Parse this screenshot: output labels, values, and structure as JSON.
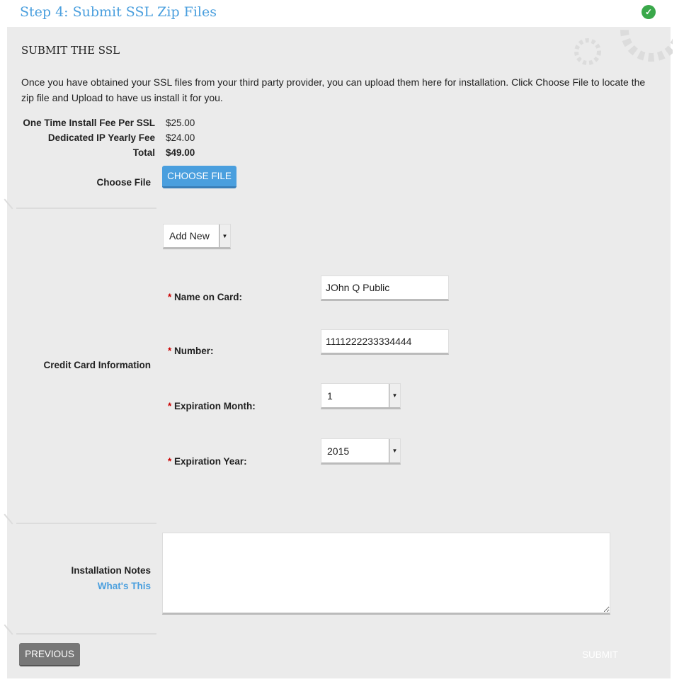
{
  "header": {
    "title": "Step 4: Submit SSL Zip Files"
  },
  "section": {
    "title": "SUBMIT THE SSL",
    "description": "Once you have obtained your SSL files from your third party provider, you can upload them here for installation. Click Choose File to locate the zip file and Upload to have us install it for you."
  },
  "fees": [
    {
      "label": "One Time Install Fee Per SSL",
      "value": "$25.00"
    },
    {
      "label": "Dedicated IP Yearly Fee",
      "value": "$24.00"
    },
    {
      "label": "Total",
      "value": "$49.00"
    }
  ],
  "choose_file": {
    "label": "Choose File",
    "button": "CHOOSE FILE"
  },
  "card": {
    "section_label": "Credit Card Information",
    "select": "Add New",
    "name_label": "Name on Card:",
    "name_value": "JOhn Q Public",
    "number_label": "Number:",
    "number_value": "1111222233334444",
    "month_label": "Expiration Month:",
    "month_value": "1",
    "year_label": "Expiration Year:",
    "year_value": "2015",
    "required": "*"
  },
  "notes": {
    "label": "Installation Notes",
    "link": "What's This"
  },
  "footer": {
    "previous": "PREVIOUS",
    "submit": "SUBMIT"
  }
}
